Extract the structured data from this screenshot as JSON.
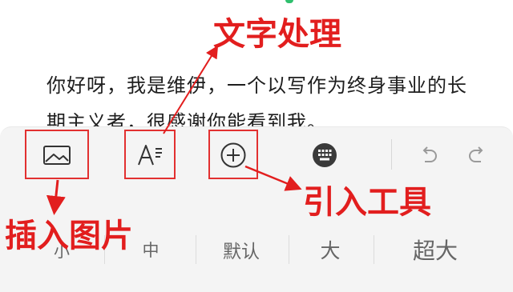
{
  "article": {
    "line1": "你好呀，我是维伊，一个以写作为终身事业的长",
    "line2": "期主义者，很感谢你能看到我。"
  },
  "toolbar": {
    "tools": [
      {
        "name": "insert-image",
        "icon": "image-icon"
      },
      {
        "name": "text-format",
        "icon": "text-format-icon"
      },
      {
        "name": "insert-tool",
        "icon": "plus-circle-icon"
      },
      {
        "name": "keyboard",
        "icon": "keyboard-icon"
      },
      {
        "name": "undo",
        "icon": "undo-icon"
      },
      {
        "name": "redo",
        "icon": "redo-icon"
      }
    ]
  },
  "font_sizes": {
    "small": "小",
    "medium": "中",
    "default": "默认",
    "large": "大",
    "extra_large": "超大"
  },
  "annotations": {
    "text_processing": "文字处理",
    "import_tool": "引入工具",
    "insert_image": "插入图片"
  },
  "colors": {
    "annotation_red": "#e21e1e",
    "panel_bg": "#f4f4f4",
    "top_hint_green": "#2fbf6d"
  }
}
